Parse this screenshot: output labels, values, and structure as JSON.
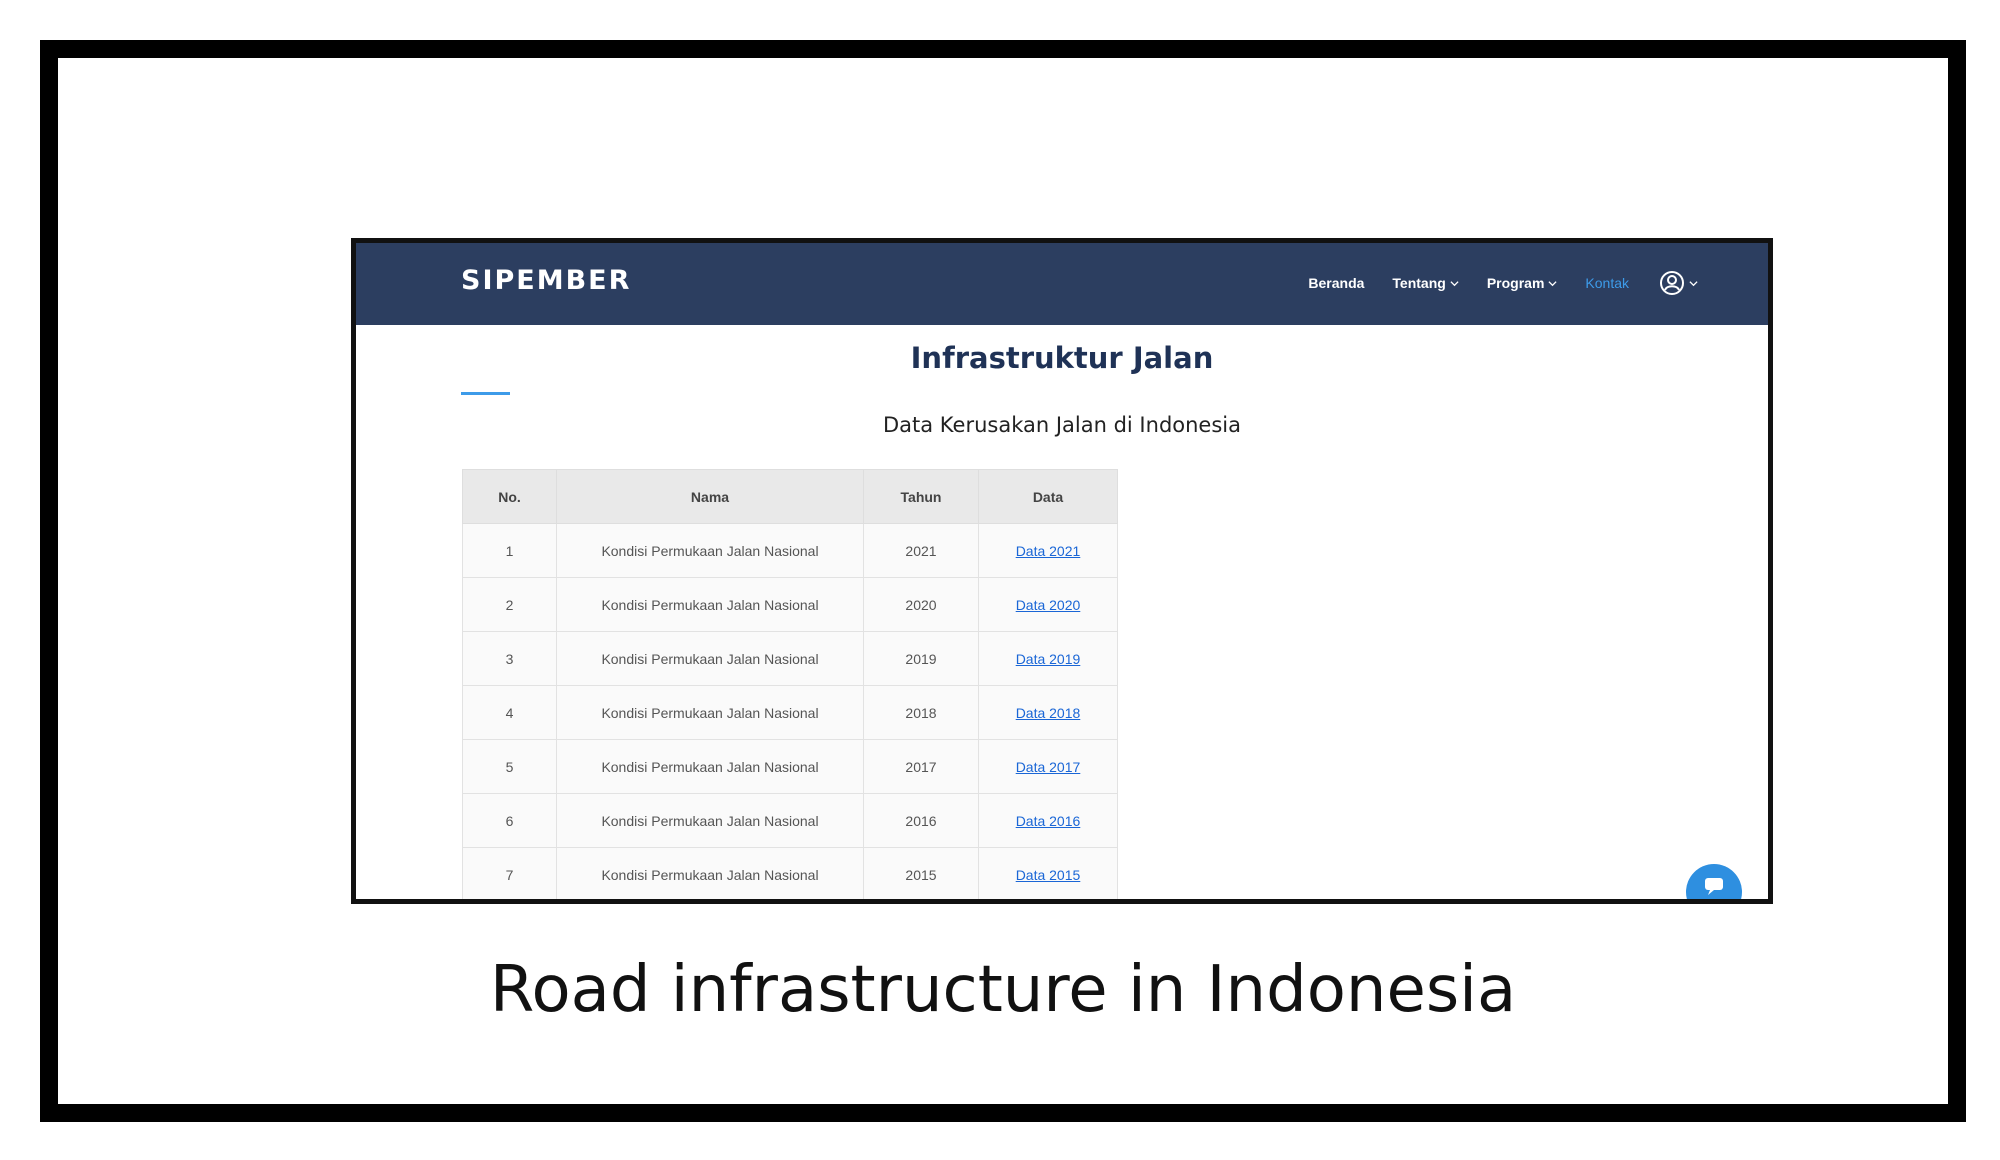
{
  "navbar": {
    "brand": "SIPEMBER",
    "items": [
      {
        "label": "Beranda"
      },
      {
        "label": "Tentang"
      },
      {
        "label": "Program"
      },
      {
        "label": "Kontak"
      }
    ]
  },
  "main": {
    "title": "Infrastruktur Jalan",
    "subtitle": "Data Kerusakan Jalan di Indonesia"
  },
  "table": {
    "headers": [
      "No.",
      "Nama",
      "Tahun",
      "Data"
    ],
    "rows": [
      [
        "1",
        "Kondisi Permukaan Jalan Nasional",
        "2021",
        "Data 2021"
      ],
      [
        "2",
        "Kondisi Permukaan Jalan Nasional",
        "2020",
        "Data 2020"
      ],
      [
        "3",
        "Kondisi Permukaan Jalan Nasional",
        "2019",
        "Data 2019"
      ],
      [
        "4",
        "Kondisi Permukaan Jalan Nasional",
        "2018",
        "Data 2018"
      ],
      [
        "5",
        "Kondisi Permukaan Jalan Nasional",
        "2017",
        "Data 2017"
      ],
      [
        "6",
        "Kondisi Permukaan Jalan Nasional",
        "2016",
        "Data 2016"
      ],
      [
        "7",
        "Kondisi Permukaan Jalan Nasional",
        "2015",
        "Data 2015"
      ]
    ]
  },
  "caption": "Road infrastructure in Indonesia",
  "colors": {
    "navbar_bg": "#2c3e60",
    "accent": "#3d9be9",
    "link": "#1a66d6",
    "title": "#1f3256"
  },
  "icons": [
    "chevron-down-icon",
    "user-circle-icon",
    "chat-icon"
  ]
}
